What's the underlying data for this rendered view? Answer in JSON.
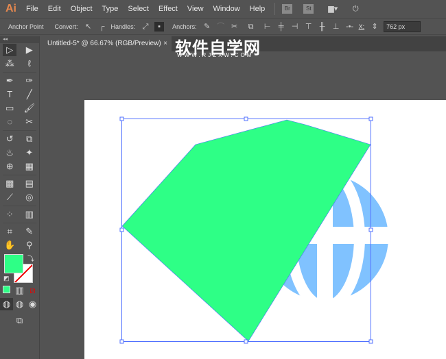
{
  "app": {
    "logo": "Ai"
  },
  "menu": [
    "File",
    "Edit",
    "Object",
    "Type",
    "Select",
    "Effect",
    "View",
    "Window",
    "Help"
  ],
  "bridge": {
    "br": "Br",
    "st": "St"
  },
  "control": {
    "tool_label": "Anchor Point",
    "convert": "Convert:",
    "handles": "Handles:",
    "anchors": "Anchors:",
    "x_label": "X:",
    "x_value": "762 px"
  },
  "tab": {
    "title": "Untitled-5* @ 66.67% (RGB/Preview)",
    "close": "×"
  },
  "watermark": {
    "cn": "软件自学网",
    "url": "WWW.RJZXW.COM"
  },
  "colors": {
    "fill": "#2EFF86",
    "stroke": "none",
    "globe": "#80C2FF",
    "selection": "#4f6fff"
  }
}
